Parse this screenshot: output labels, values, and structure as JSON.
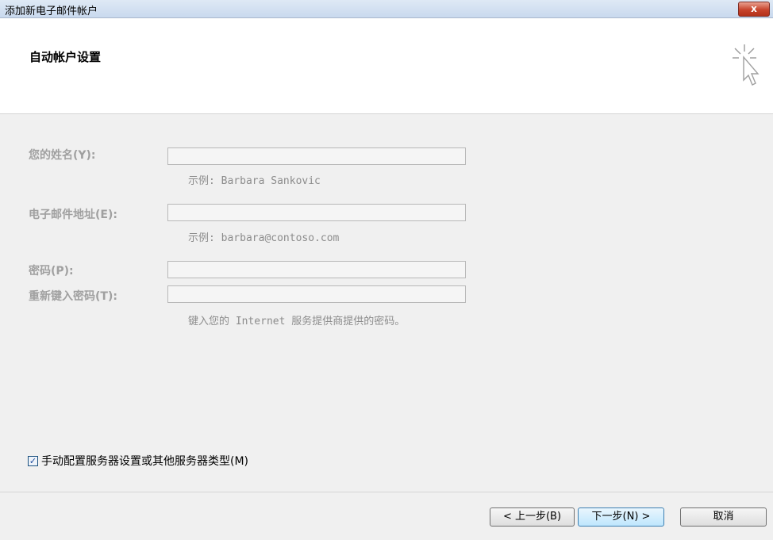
{
  "window": {
    "title": "添加新电子邮件帐户",
    "close_label": "x"
  },
  "header": {
    "heading": "自动帐户设置"
  },
  "form": {
    "name": {
      "label": "您的姓名(Y):",
      "value": "",
      "hint": "示例: Barbara Sankovic"
    },
    "email": {
      "label": "电子邮件地址(E):",
      "value": "",
      "hint": "示例: barbara@contoso.com"
    },
    "password": {
      "label": "密码(P):",
      "value": ""
    },
    "retype": {
      "label": "重新键入密码(T):",
      "value": "",
      "hint": "键入您的 Internet 服务提供商提供的密码。"
    }
  },
  "manual": {
    "label": "手动配置服务器设置或其他服务器类型(M)",
    "checked": true,
    "check_glyph": "✓"
  },
  "buttons": {
    "back": "< 上一步(B)",
    "next": "下一步(N) >",
    "cancel": "取消"
  }
}
